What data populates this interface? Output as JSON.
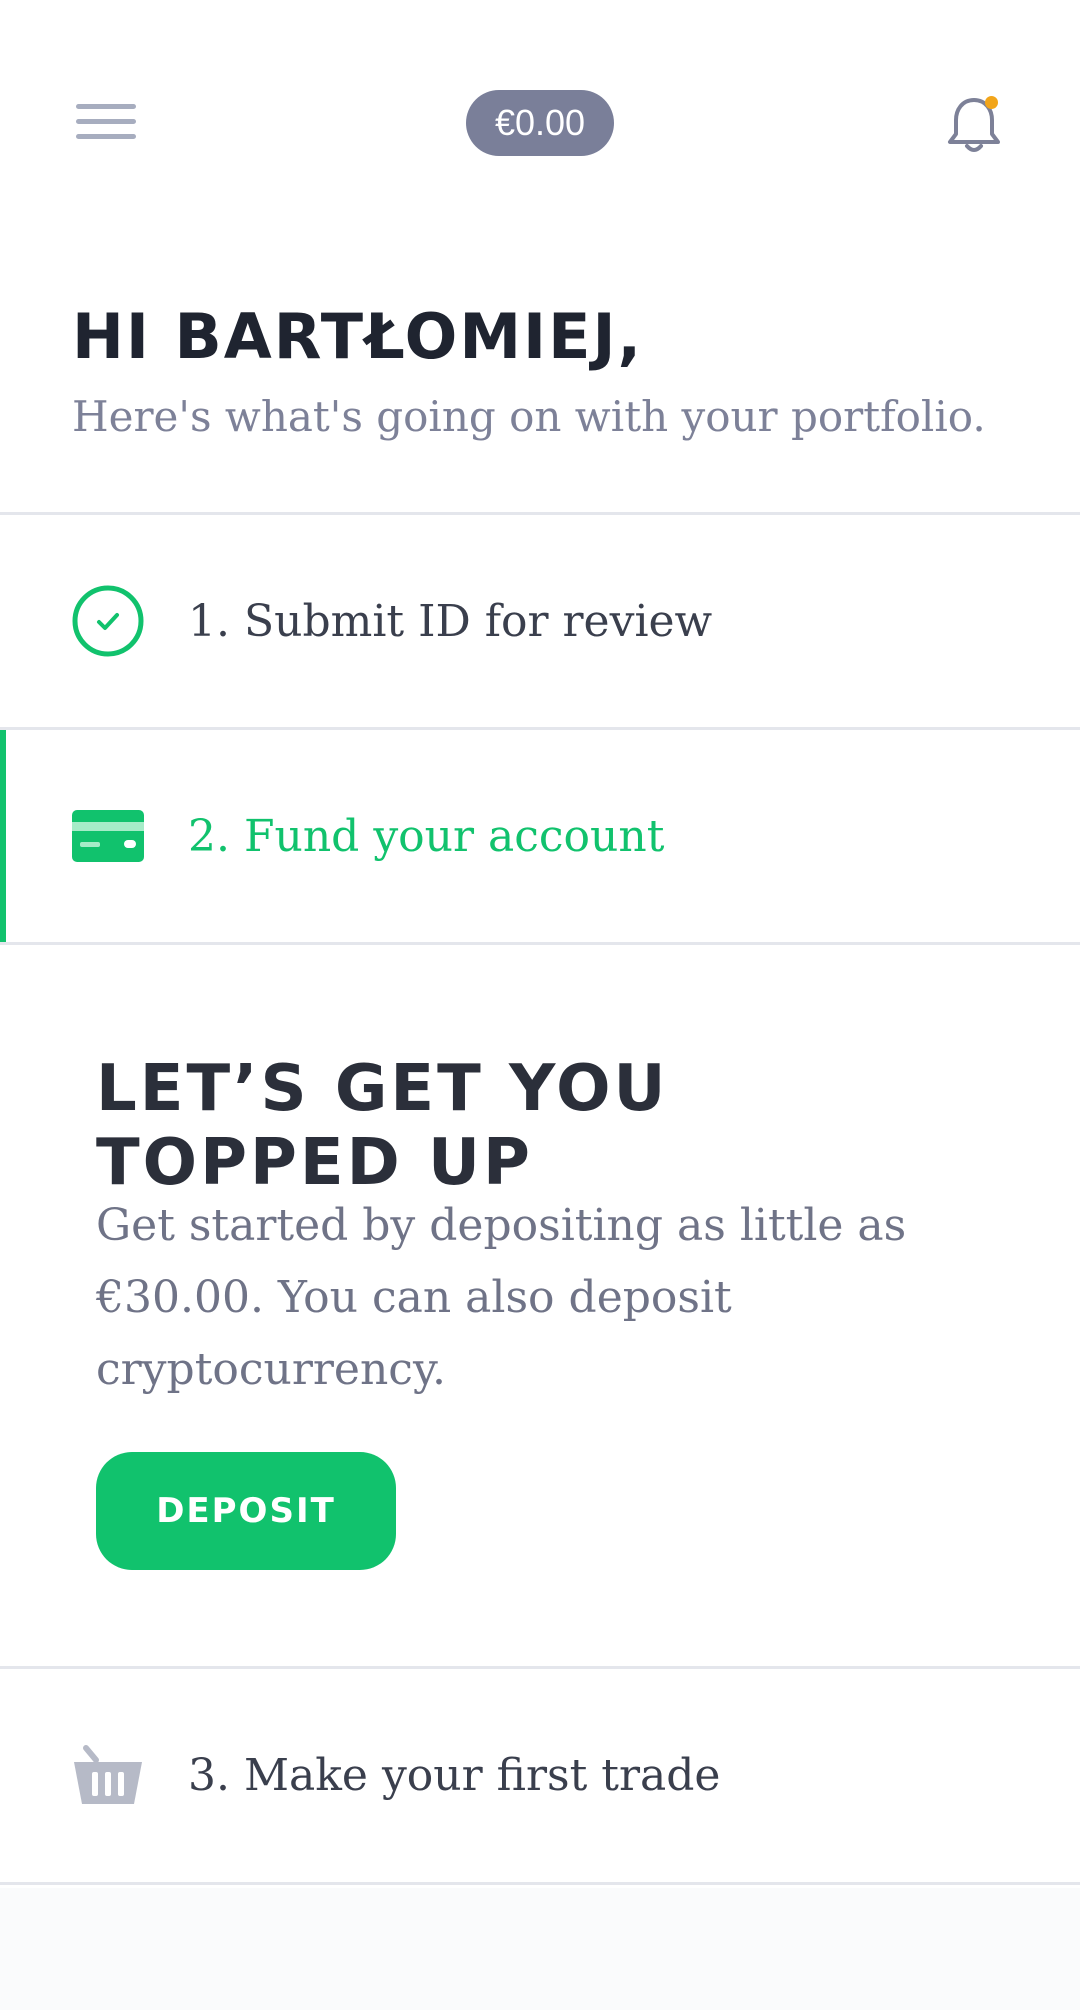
{
  "header": {
    "menu_icon": "hamburger-menu-icon",
    "balance": "€0.00",
    "notifications_icon": "bell-icon",
    "notification_dot_color": "#f2a51a"
  },
  "greeting": {
    "title": "HI BARTŁOMIEJ,",
    "subtitle": "Here's what's going on with your portfolio."
  },
  "steps": [
    {
      "label": "1. Submit ID for review",
      "icon": "check-circle-icon",
      "status": "completed"
    },
    {
      "label": "2. Fund your account",
      "icon": "credit-card-icon",
      "status": "active"
    },
    {
      "label": "3. Make your first trade",
      "icon": "basket-icon",
      "status": "pending"
    }
  ],
  "topup": {
    "title": "LET’S GET YOU TOPPED UP",
    "description": "Get started by depositing as little as €30.00. You can also deposit cryptocurrency.",
    "button_label": "DEPOSIT"
  },
  "colors": {
    "accent": "#11c26d",
    "pill": "#7a7f99",
    "muted_text": "#7d8198",
    "divider": "#e4e6ec"
  }
}
